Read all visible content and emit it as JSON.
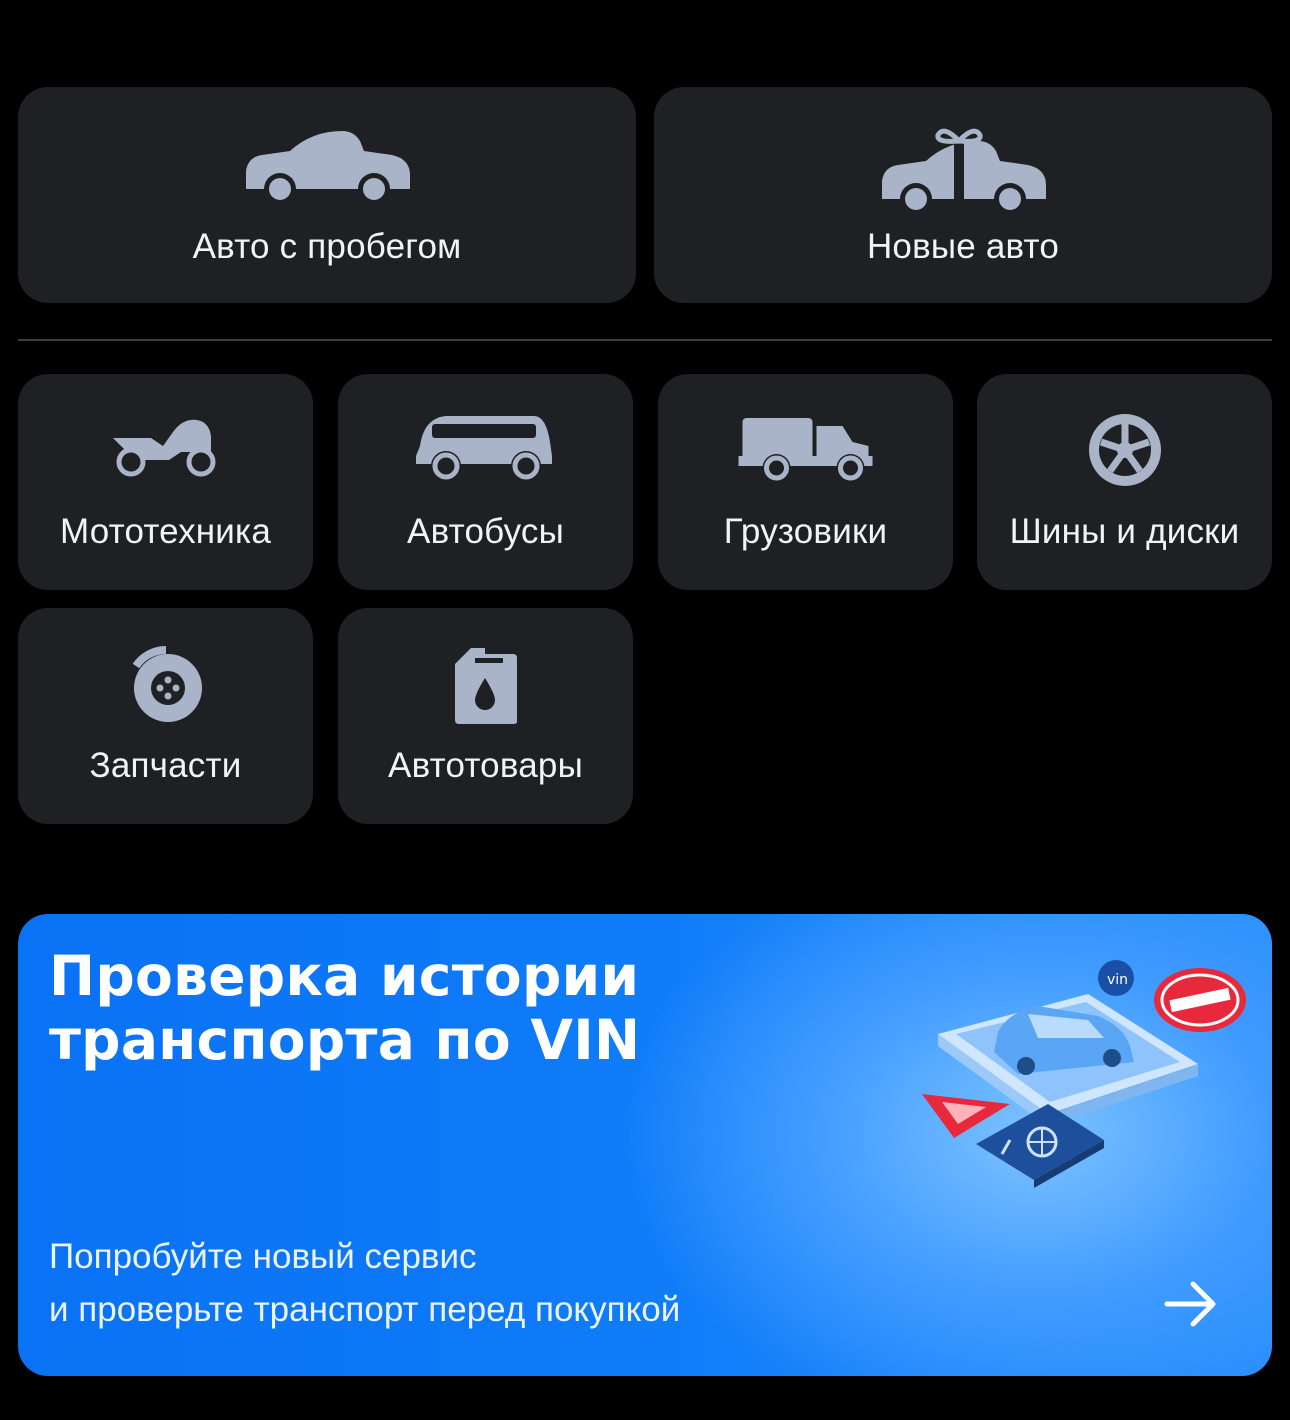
{
  "categories_main": [
    {
      "label": "Авто с пробегом",
      "icon": "car-icon"
    },
    {
      "label": "Новые авто",
      "icon": "gift-car-icon"
    }
  ],
  "categories_other": [
    {
      "label": "Мототехника",
      "icon": "motorcycle-icon"
    },
    {
      "label": "Автобусы",
      "icon": "bus-icon"
    },
    {
      "label": "Грузовики",
      "icon": "truck-icon"
    },
    {
      "label": "Шины и диски",
      "icon": "wheel-icon"
    },
    {
      "label": "Запчасти",
      "icon": "brake-disc-icon"
    },
    {
      "label": "Автотовары",
      "icon": "oil-canister-icon"
    }
  ],
  "banner": {
    "title_line1": "Проверка истории",
    "title_line2": "транспорта по VIN",
    "subtitle_line1": "Попробуйте новый сервис",
    "subtitle_line2": "и проверьте транспорт перед покупкой",
    "art_vin_badge": "vin"
  },
  "colors": {
    "background": "#000000",
    "tile": "#1f2024",
    "icon": "#a9b4c8",
    "banner": "#0f7cf8"
  }
}
